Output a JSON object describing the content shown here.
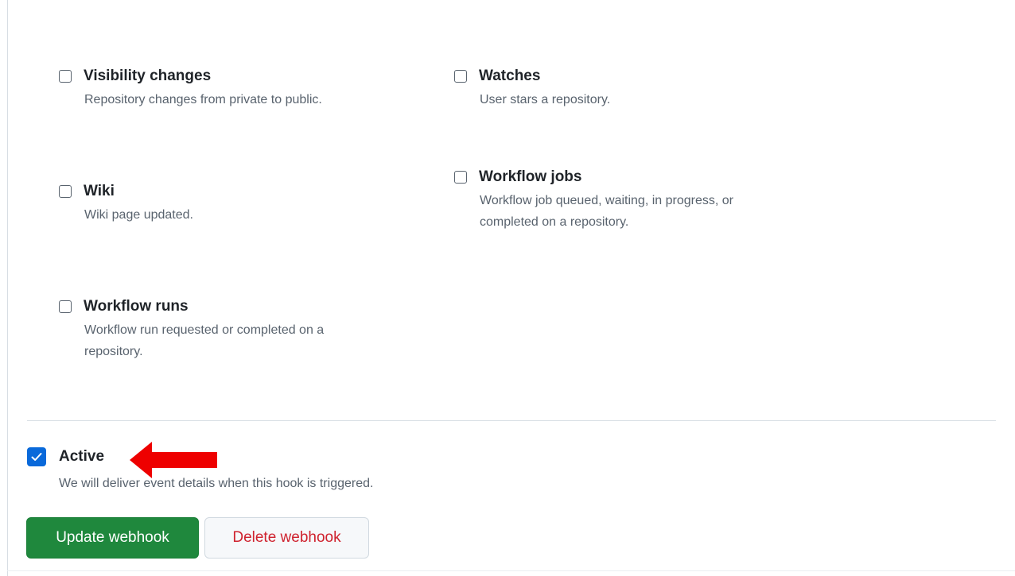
{
  "events": [
    {
      "title": "Visibility changes",
      "description": "Repository changes from private to public.",
      "checked": false
    },
    {
      "title": "Watches",
      "description": "User stars a repository.",
      "checked": false
    },
    {
      "title": "Wiki",
      "description": "Wiki page updated.",
      "checked": false
    },
    {
      "title": "Workflow jobs",
      "description_lines": [
        "Workflow job queued, waiting, in progress, or",
        "completed on a repository."
      ],
      "checked": false
    },
    {
      "title": "Workflow runs",
      "description_lines": [
        "Workflow run requested or completed on a",
        "repository."
      ],
      "checked": false
    }
  ],
  "active": {
    "label": "Active",
    "description": "We will deliver event details when this hook is triggered.",
    "checked": true
  },
  "buttons": {
    "update_label": "Update webhook",
    "delete_label": "Delete webhook"
  },
  "colors": {
    "primary_button": "#1f883d",
    "danger_text": "#cf222e",
    "checkbox_checked": "#0969da",
    "annotation_arrow": "#ee0000"
  },
  "icons": {
    "checkmark": "check-icon",
    "annotation": "red-arrow-icon"
  }
}
